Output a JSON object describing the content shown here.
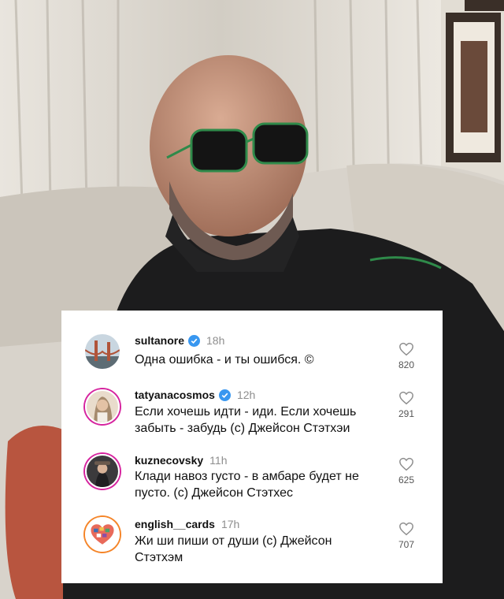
{
  "comments": [
    {
      "username": "sultanore",
      "verified": true,
      "time": "18h",
      "text": "Одна ошибка - и ты ошибся. ©",
      "likes": "820",
      "avatar_icon": "golden-gate-photo"
    },
    {
      "username": "tatyanacosmos",
      "verified": true,
      "time": "12h",
      "text": "Если хочешь идти - иди. Если хочешь забыть - забудь (с) Джейсон Стэтхэи",
      "likes": "291",
      "avatar_icon": "woman-portrait-photo"
    },
    {
      "username": "kuznecovsky",
      "verified": false,
      "time": "11h",
      "text": "Клади навоз густо - в амбаре будет не пусто. (с) Джейсон Стэтхес",
      "likes": "625",
      "avatar_icon": "man-portrait-photo"
    },
    {
      "username": "english__cards",
      "verified": false,
      "time": "17h",
      "text": "Жи ши пиши от души (с) Джейсон Стэтхэм",
      "likes": "707",
      "avatar_icon": "heart-collage-photo"
    }
  ],
  "colors": {
    "verified_blue": "#3897f0",
    "story_ring": "#d6249f"
  }
}
